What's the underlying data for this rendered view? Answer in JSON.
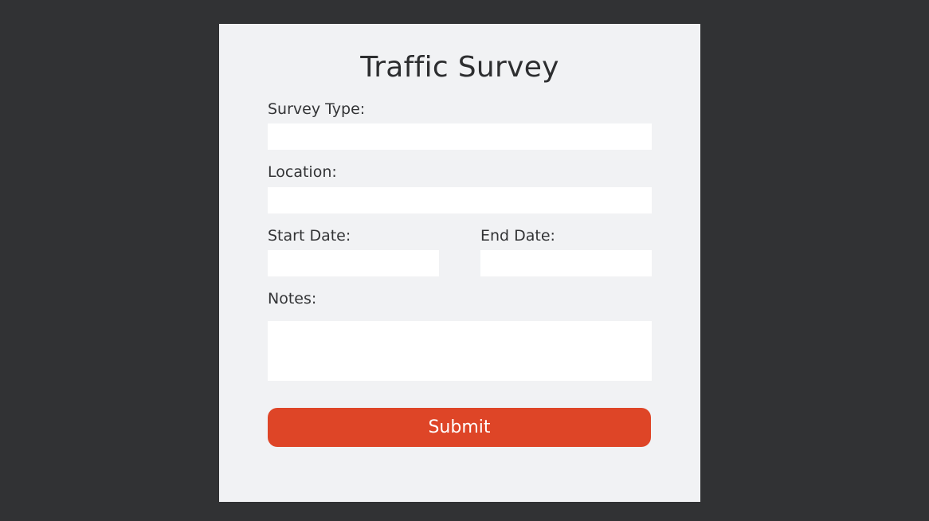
{
  "form": {
    "title": "Traffic Survey",
    "fields": {
      "survey_type": {
        "label": "Survey Type:",
        "value": ""
      },
      "location": {
        "label": "Location:",
        "value": ""
      },
      "start_date": {
        "label": "Start Date:",
        "value": ""
      },
      "end_date": {
        "label": "End Date:",
        "value": ""
      },
      "notes": {
        "label": "Notes:",
        "value": ""
      }
    },
    "submit_label": "Submit"
  },
  "colors": {
    "background": "#313234",
    "card": "#f1f2f4",
    "accent": "#de4527"
  }
}
